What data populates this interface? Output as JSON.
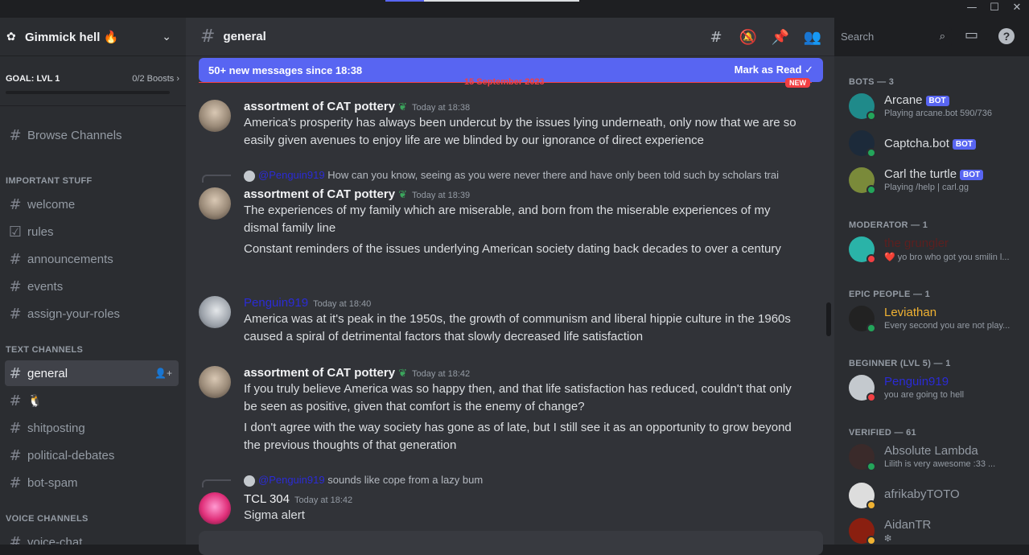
{
  "server": {
    "name": "Gimmick hell 🔥"
  },
  "goal": {
    "label": "GOAL: LVL 1",
    "boosts": "0/2 Boosts"
  },
  "sidebar": {
    "browse": "Browse Channels",
    "cat_important": "IMPORTANT STUFF",
    "cat_text": "TEXT CHANNELS",
    "cat_voice": "VOICE CHANNELS",
    "important": [
      "welcome",
      "rules",
      "announcements",
      "events",
      "assign-your-roles"
    ],
    "text": [
      "general",
      "🐧",
      "shitposting",
      "political-debates",
      "bot-spam"
    ],
    "voice": [
      "voice-chat"
    ]
  },
  "header": {
    "channel": "general",
    "search_placeholder": "Search"
  },
  "banner": {
    "text": "50+ new messages since 18:38",
    "mark": "Mark as Read"
  },
  "divider": {
    "date": "15 September 2023",
    "new": "NEW"
  },
  "messages": [
    {
      "author": "assortment of CAT pottery",
      "ts": "Today at 18:38",
      "lines": [
        "America's prosperity has always been undercut by the issues lying underneath, only now that we are so easily given avenues to enjoy life are we blinded by our ignorance of direct experience"
      ]
    },
    {
      "reply_mention": "@Penguin919",
      "reply_text": "How can you know, seeing as you were never there and have only been told such by scholars trai",
      "author": "assortment of CAT pottery",
      "ts": "Today at 18:39",
      "lines": [
        "The experiences of my family which are miserable, and born from the miserable experiences of my dismal family line",
        "Constant reminders of the issues underlying American society dating back decades to over a century"
      ]
    },
    {
      "author": "Penguin919",
      "ts": "Today at 18:40",
      "lines": [
        "America was at it's peak in the 1950s, the growth of communism and liberal hippie culture in the 1960s caused a spiral of detrimental factors that slowly decreased life satisfaction"
      ]
    },
    {
      "author": "assortment of CAT pottery",
      "ts": "Today at 18:42",
      "lines": [
        "If you truly believe America was so happy then, and that life satisfaction has reduced, couldn't that only be seen as positive, given that comfort is the enemy of change?",
        "I don't agree with the way society has gone as of late, but I still see it as an opportunity to grow beyond the previous thoughts of that generation"
      ]
    },
    {
      "reply_mention": "@Penguin919",
      "reply_text": "sounds like cope from a lazy bum",
      "author": "TCL 304",
      "ts": "Today at 18:42",
      "lines": [
        "Sigma alert"
      ]
    }
  ],
  "members": {
    "cat_bots": "BOTS — 3",
    "cat_mod": "MODERATOR — 1",
    "cat_epic": "EPIC PEOPLE — 1",
    "cat_beginner": "BEGINNER (LVL 5) — 1",
    "cat_verified": "VERIFIED — 61",
    "bot_tag": "BOT",
    "list": [
      {
        "name": "Arcane",
        "sub": "Playing arcane.bot 590/736"
      },
      {
        "name": "Captcha.bot",
        "sub": ""
      },
      {
        "name": "Carl the turtle",
        "sub": "Playing /help | carl.gg"
      },
      {
        "name": "the grungler",
        "sub": "❤️ yo bro who got you smilin l..."
      },
      {
        "name": "Leviathan",
        "sub": "Every second you are not play..."
      },
      {
        "name": "Penguin919",
        "sub": "you are going to hell"
      },
      {
        "name": "Absolute Lambda",
        "sub": "Lilith is very awesome :33 ..."
      },
      {
        "name": "afrikabyTOTO",
        "sub": ""
      },
      {
        "name": "AidanTR",
        "sub": "❇"
      }
    ]
  },
  "colors": {
    "accent": "#5865f2",
    "online": "#23a55a",
    "dnd": "#f23f43",
    "idle": "#f0b232",
    "mod_name": "#5c1f1f",
    "epic_name": "#f0b232",
    "penguin_name": "#2b2bd5"
  }
}
